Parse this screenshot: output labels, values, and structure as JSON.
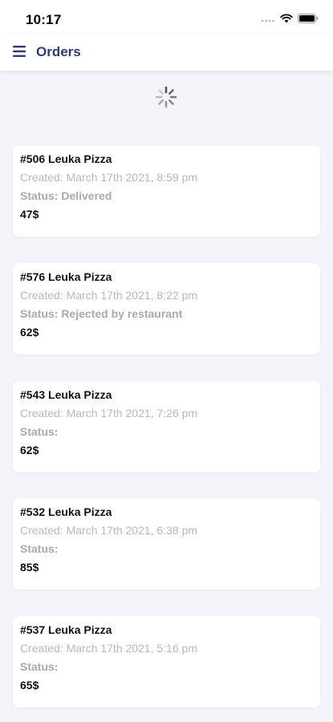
{
  "status_bar": {
    "time": "10:17"
  },
  "nav": {
    "title": "Orders",
    "menu_icon": "hamburger-menu-icon"
  },
  "loading": {
    "icon": "loading-spinner-icon"
  },
  "orders": [
    {
      "title": "#506 Leuka Pizza",
      "created": "Created: March 17th 2021, 8:59 pm",
      "status": "Status: Delivered",
      "price": "47$"
    },
    {
      "title": "#576 Leuka Pizza",
      "created": "Created: March 17th 2021, 8:22 pm",
      "status": "Status: Rejected by restaurant",
      "price": "62$"
    },
    {
      "title": "#543 Leuka Pizza",
      "created": "Created: March 17th 2021, 7:26 pm",
      "status": "Status:",
      "price": "62$"
    },
    {
      "title": "#532 Leuka Pizza",
      "created": "Created: March 17th 2021, 6:38 pm",
      "status": "Status:",
      "price": "85$"
    },
    {
      "title": "#537 Leuka Pizza",
      "created": "Created: March 17th 2021, 5:16 pm",
      "status": "Status:",
      "price": "65$"
    }
  ]
}
